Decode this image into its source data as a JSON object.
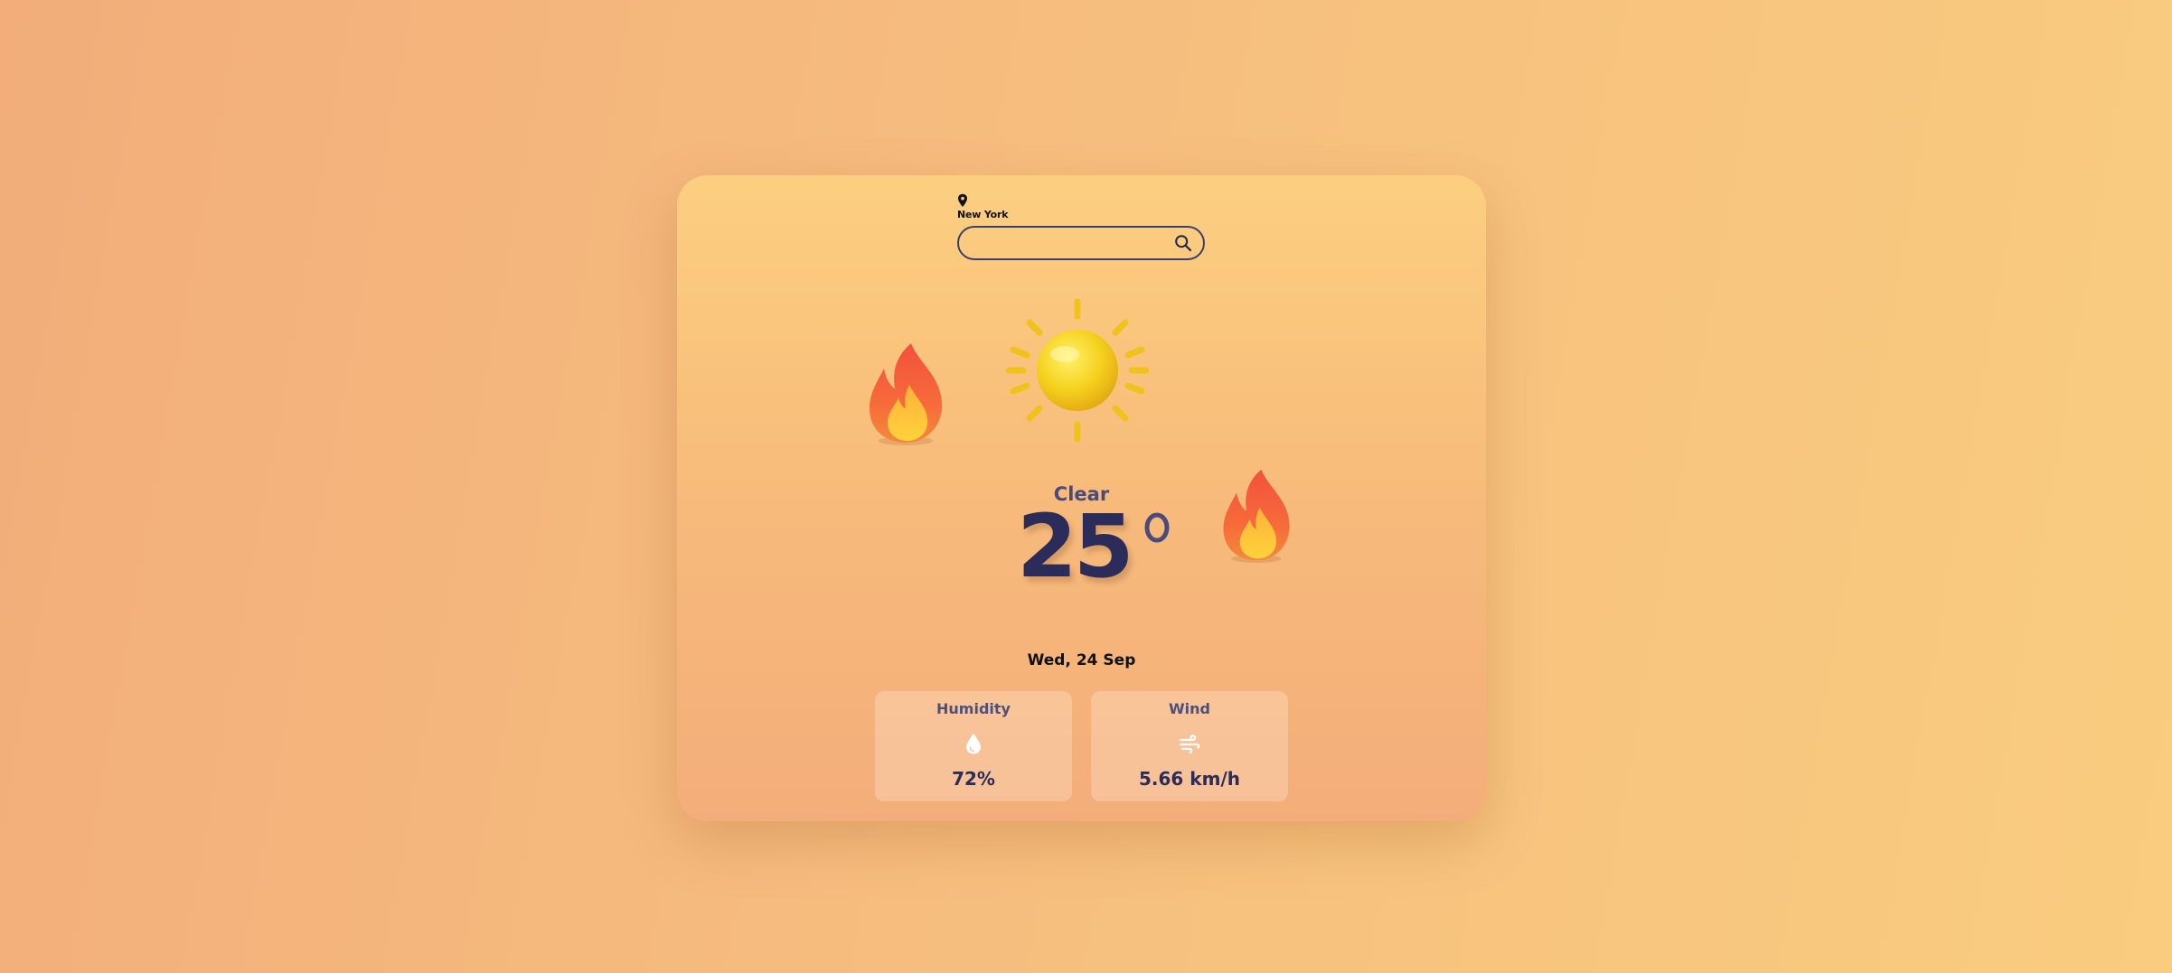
{
  "location": {
    "icon": "map-pin-icon",
    "city": "New York"
  },
  "search": {
    "placeholder": "",
    "value": "",
    "icon": "search-icon"
  },
  "weather": {
    "icon": "sun-icon",
    "decorations": [
      "flame-icon",
      "flame-icon"
    ],
    "condition": "Clear",
    "temperature": "25",
    "unit_icon": "degree-icon",
    "date": "Wed, 24 Sep"
  },
  "stats": {
    "humidity": {
      "label": "Humidity",
      "icon": "water-drop-icon",
      "value": "72%"
    },
    "wind": {
      "label": "Wind",
      "icon": "wind-icon",
      "value": "5.66 km/h"
    }
  },
  "colors": {
    "background": "#f6bd7e",
    "card_top": "#fccf80",
    "card_bottom": "#f3ad7a",
    "text_primary": "#2b2c5a",
    "text_secondary": "#4a4b7a"
  }
}
